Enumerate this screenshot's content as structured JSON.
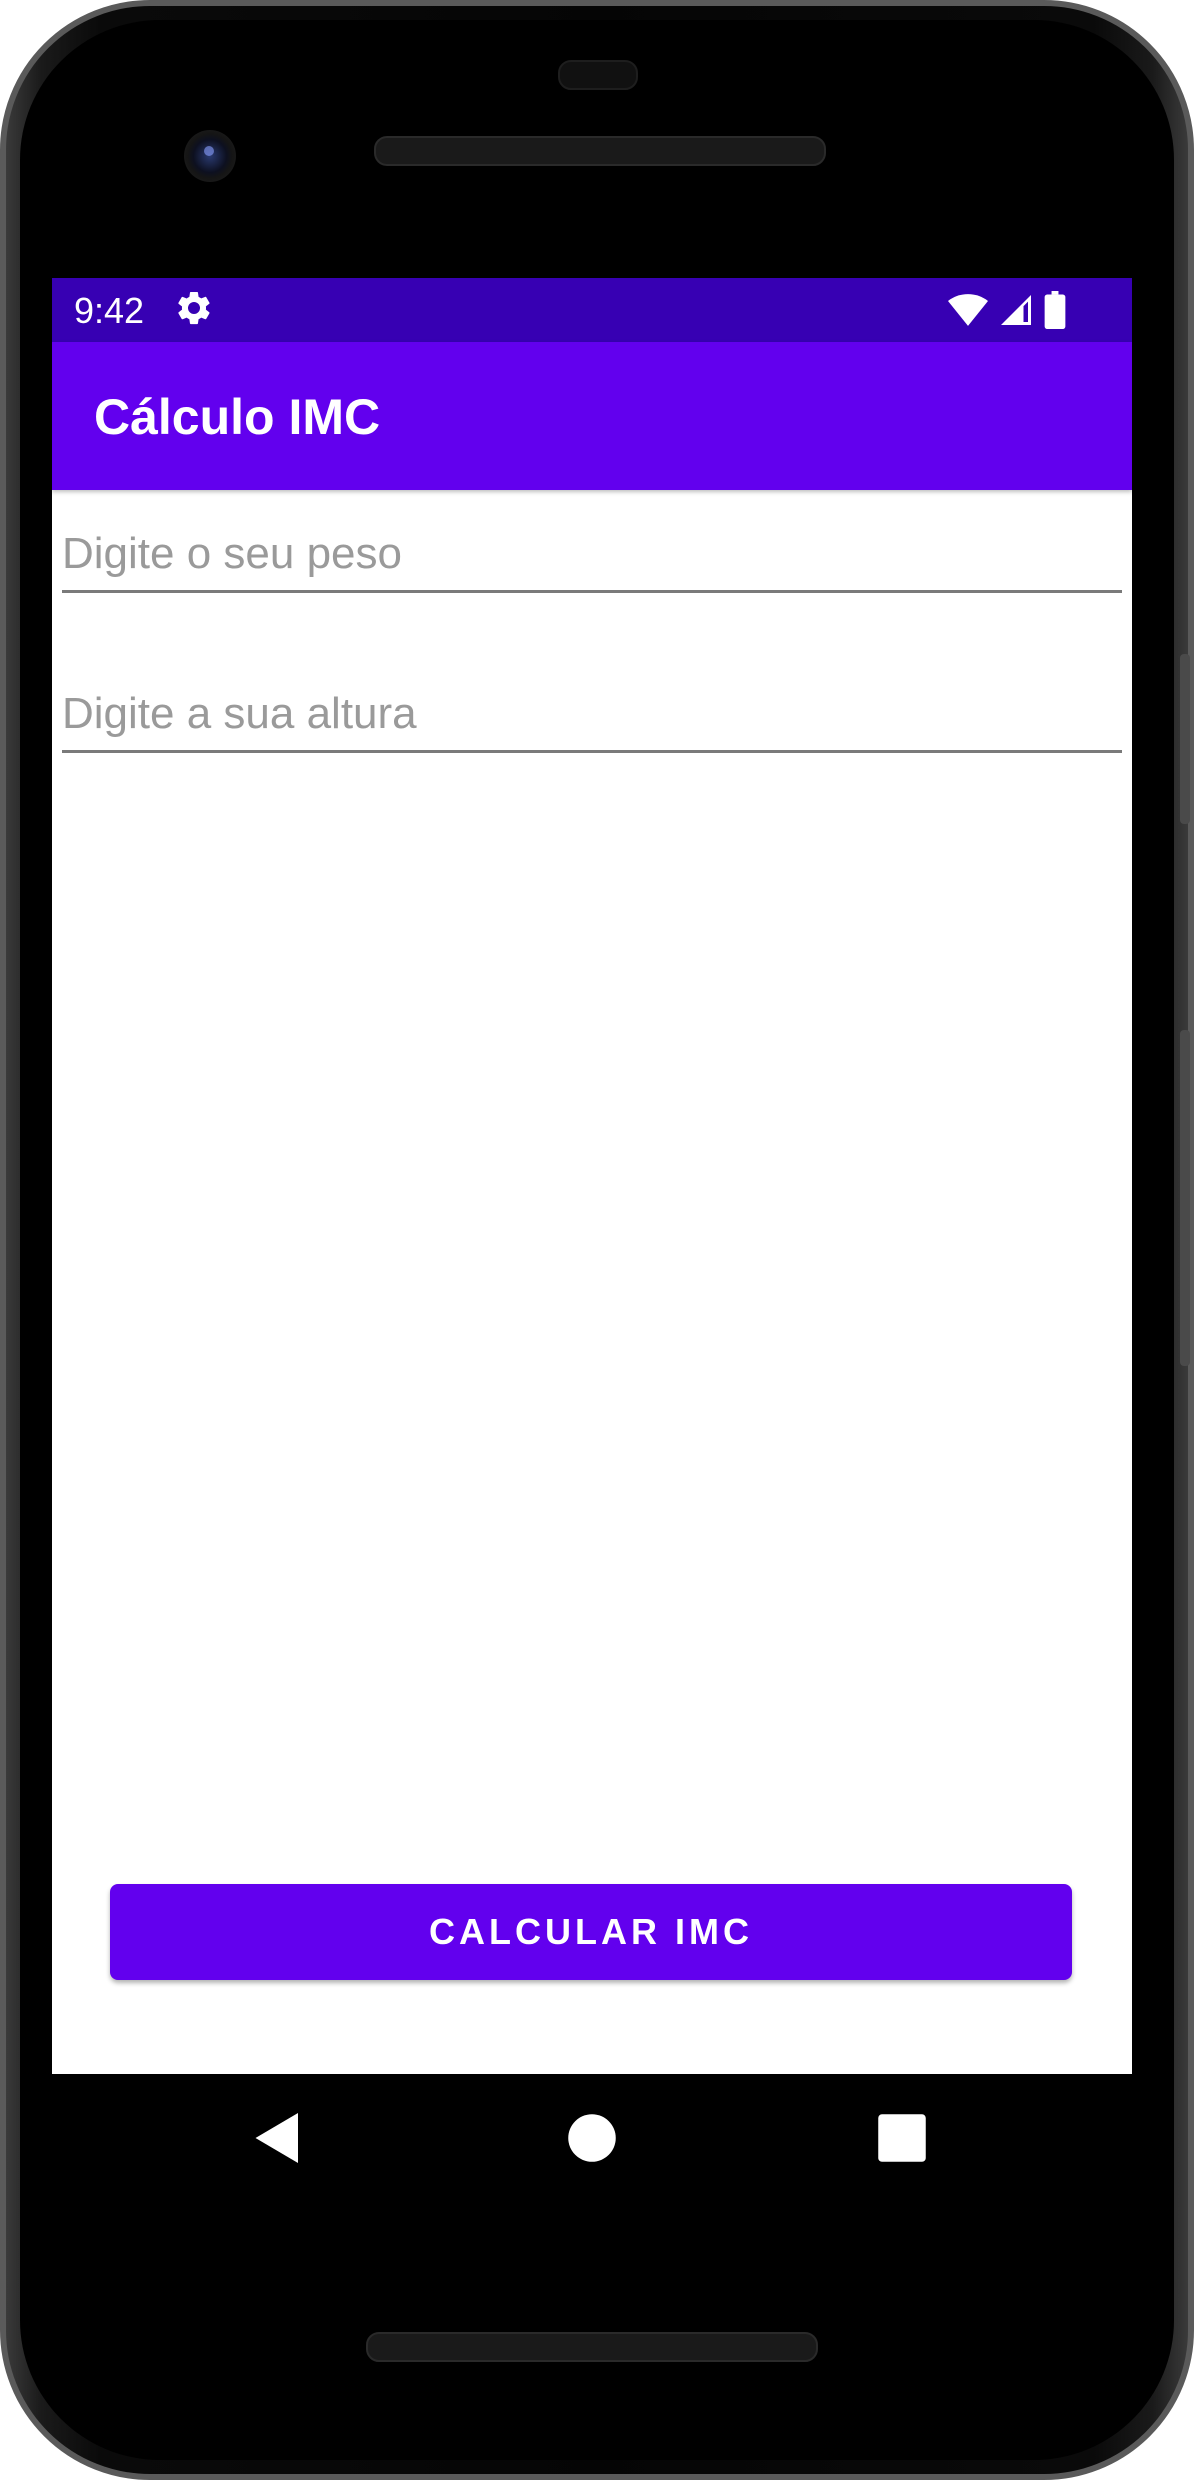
{
  "status_bar": {
    "time": "9:42",
    "icons": [
      "settings-gear-icon",
      "wifi-icon",
      "cell-signal-icon",
      "battery-icon"
    ]
  },
  "app_bar": {
    "title": "Cálculo IMC"
  },
  "form": {
    "weight_placeholder": "Digite o seu peso",
    "weight_value": "",
    "height_placeholder": "Digite a sua altura",
    "height_value": ""
  },
  "actions": {
    "calculate_label": "CALCULAR IMC"
  },
  "nav_bar": {
    "icons": [
      "back-triangle-icon",
      "home-circle-icon",
      "recents-square-icon"
    ]
  },
  "colors": {
    "primary": "#6200EE",
    "primary_dark": "#3700B3",
    "on_primary": "#FFFFFF",
    "hint": "#9A9A9A"
  }
}
